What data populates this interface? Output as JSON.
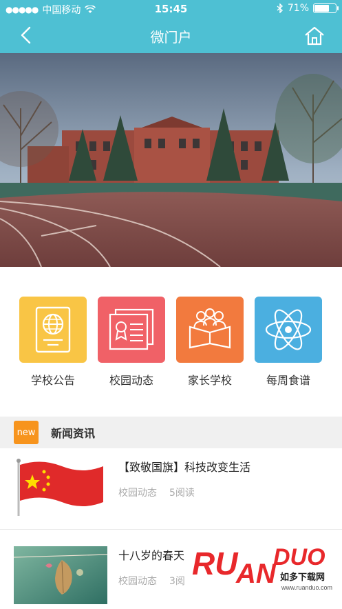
{
  "status_bar": {
    "carrier": "中国移动",
    "time": "15:45",
    "battery": "71%",
    "battery_level": 0.71
  },
  "nav": {
    "title": "微门户",
    "back_icon": "chevron-left-icon",
    "home_icon": "home-icon"
  },
  "menu": {
    "items": [
      {
        "label": "学校公告",
        "icon": "globe-passport-icon",
        "color": "#f9c545"
      },
      {
        "label": "校园动态",
        "icon": "certificate-icon",
        "color": "#f06167"
      },
      {
        "label": "家长学校",
        "icon": "family-book-icon",
        "color": "#f27a3e"
      },
      {
        "label": "每周食谱",
        "icon": "atom-icon",
        "color": "#4bafe0"
      }
    ]
  },
  "news_section": {
    "badge": "new",
    "title": "新闻资讯",
    "items": [
      {
        "title": "【致敬国旗】科技改变生活",
        "category": "校园动态",
        "reads": "5阅读"
      },
      {
        "title": "十八岁的春天",
        "category": "校园动态",
        "reads": "3阅"
      }
    ]
  },
  "watermark": {
    "brand": "RUANDUO",
    "slogan": "如多下载网",
    "url": "www.ruanduo.com"
  },
  "colors": {
    "accent": "#4ec0d3",
    "badge": "#f7941d"
  }
}
